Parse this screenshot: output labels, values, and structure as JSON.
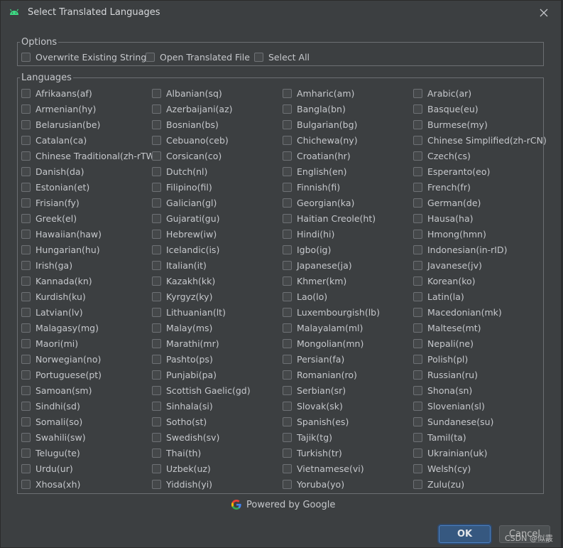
{
  "dialog": {
    "title": "Select Translated Languages",
    "options_legend": "Options",
    "languages_legend": "Languages",
    "powered_by": "Powered by Google",
    "ok_label": "OK",
    "cancel_label": "Cancel",
    "watermark": "CSDN @似霰"
  },
  "options": [
    {
      "label": "Overwrite Existing String",
      "checked": false
    },
    {
      "label": "Open Translated File",
      "checked": false
    },
    {
      "label": "Select All",
      "checked": false
    }
  ],
  "languages": [
    [
      "Afrikaans(af)",
      "Albanian(sq)",
      "Amharic(am)",
      "Arabic(ar)"
    ],
    [
      "Armenian(hy)",
      "Azerbaijani(az)",
      "Bangla(bn)",
      "Basque(eu)"
    ],
    [
      "Belarusian(be)",
      "Bosnian(bs)",
      "Bulgarian(bg)",
      "Burmese(my)"
    ],
    [
      "Catalan(ca)",
      "Cebuano(ceb)",
      "Chichewa(ny)",
      "Chinese Simplified(zh-rCN)"
    ],
    [
      "Chinese Traditional(zh-rTW)",
      "Corsican(co)",
      "Croatian(hr)",
      "Czech(cs)"
    ],
    [
      "Danish(da)",
      "Dutch(nl)",
      "English(en)",
      "Esperanto(eo)"
    ],
    [
      "Estonian(et)",
      "Filipino(fil)",
      "Finnish(fi)",
      "French(fr)"
    ],
    [
      "Frisian(fy)",
      "Galician(gl)",
      "Georgian(ka)",
      "German(de)"
    ],
    [
      "Greek(el)",
      "Gujarati(gu)",
      "Haitian Creole(ht)",
      "Hausa(ha)"
    ],
    [
      "Hawaiian(haw)",
      "Hebrew(iw)",
      "Hindi(hi)",
      "Hmong(hmn)"
    ],
    [
      "Hungarian(hu)",
      "Icelandic(is)",
      "Igbo(ig)",
      "Indonesian(in-rID)"
    ],
    [
      "Irish(ga)",
      "Italian(it)",
      "Japanese(ja)",
      "Javanese(jv)"
    ],
    [
      "Kannada(kn)",
      "Kazakh(kk)",
      "Khmer(km)",
      "Korean(ko)"
    ],
    [
      "Kurdish(ku)",
      "Kyrgyz(ky)",
      "Lao(lo)",
      "Latin(la)"
    ],
    [
      "Latvian(lv)",
      "Lithuanian(lt)",
      "Luxembourgish(lb)",
      "Macedonian(mk)"
    ],
    [
      "Malagasy(mg)",
      "Malay(ms)",
      "Malayalam(ml)",
      "Maltese(mt)"
    ],
    [
      "Maori(mi)",
      "Marathi(mr)",
      "Mongolian(mn)",
      "Nepali(ne)"
    ],
    [
      "Norwegian(no)",
      "Pashto(ps)",
      "Persian(fa)",
      "Polish(pl)"
    ],
    [
      "Portuguese(pt)",
      "Punjabi(pa)",
      "Romanian(ro)",
      "Russian(ru)"
    ],
    [
      "Samoan(sm)",
      "Scottish Gaelic(gd)",
      "Serbian(sr)",
      "Shona(sn)"
    ],
    [
      "Sindhi(sd)",
      "Sinhala(si)",
      "Slovak(sk)",
      "Slovenian(sl)"
    ],
    [
      "Somali(so)",
      "Sotho(st)",
      "Spanish(es)",
      "Sundanese(su)"
    ],
    [
      "Swahili(sw)",
      "Swedish(sv)",
      "Tajik(tg)",
      "Tamil(ta)"
    ],
    [
      "Telugu(te)",
      "Thai(th)",
      "Turkish(tr)",
      "Ukrainian(uk)"
    ],
    [
      "Urdu(ur)",
      "Uzbek(uz)",
      "Vietnamese(vi)",
      "Welsh(cy)"
    ],
    [
      "Xhosa(xh)",
      "Yiddish(yi)",
      "Yoruba(yo)",
      "Zulu(zu)"
    ]
  ],
  "icons": {
    "app": "android-icon",
    "close": "close-icon",
    "brand": "google-logo-icon"
  },
  "colors": {
    "background": "#3c3f41",
    "accent": "#365880",
    "android_green": "#3ddc84"
  }
}
